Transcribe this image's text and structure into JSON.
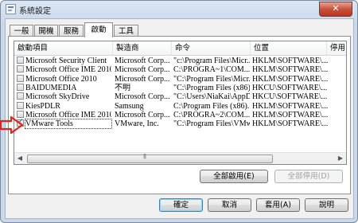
{
  "window": {
    "title": "系統設定",
    "close_label": "✕"
  },
  "tabs": [
    {
      "label": "一般",
      "active": false
    },
    {
      "label": "開機",
      "active": false
    },
    {
      "label": "服務",
      "active": false
    },
    {
      "label": "啟動",
      "active": true
    },
    {
      "label": "工具",
      "active": false
    }
  ],
  "columns": [
    "啟動項目",
    "製造商",
    "命令",
    "位置",
    "停用"
  ],
  "rows": [
    {
      "checked": false,
      "name": "Microsoft Security Client",
      "maker": "Microsoft Corp...",
      "command": "\"c:\\Program Files\\Micr...",
      "location": "HKLM\\SOFTWARE\\..."
    },
    {
      "checked": false,
      "name": "Microsoft Office IME 2010",
      "maker": "Microsoft Corp...",
      "command": "C:\\PROGRA~1\\COM...",
      "location": "HKLM\\SOFTWARE\\..."
    },
    {
      "checked": false,
      "name": "Microsoft Office 2010",
      "maker": "Microsoft Corp...",
      "command": "\"C:\\Program Files\\Micr...",
      "location": "HKLM\\SOFTWARE\\..."
    },
    {
      "checked": false,
      "name": "BAIDUMEDIA",
      "maker": "不明",
      "command": "\"C:\\Program Files (x86)...",
      "location": "HKCU\\SOFTWARE\\..."
    },
    {
      "checked": false,
      "name": "Microsoft SkyDrive",
      "maker": "Microsoft Corp...",
      "command": "\"C:\\Users\\NiaKai\\AppD...",
      "location": "HKCU\\SOFTWARE\\..."
    },
    {
      "checked": false,
      "name": "KiesPDLR",
      "maker": "Samsung",
      "command": "C:\\Program Files (x86)...",
      "location": "HKLM\\SOFTWARE\\..."
    },
    {
      "checked": false,
      "name": "Microsoft Office IME 2010",
      "maker": "Microsoft Corp...",
      "command": "C:\\PROGRA~2\\COM...",
      "location": "HKLM\\SOFTWARE\\..."
    },
    {
      "checked": true,
      "name": "VMware Tools",
      "maker": "VMware, Inc.",
      "command": "\"C:\\Program Files\\VMw...",
      "location": "HKLM\\SOFTWARE\\..."
    }
  ],
  "buttons": {
    "enable_all": "全部啟用(E)",
    "disable_all": "全部停用(D)",
    "ok": "確定",
    "cancel": "取消",
    "apply": "套用(A)",
    "help": "說明"
  },
  "colors": {
    "highlight_arrow": "#e0231c"
  }
}
